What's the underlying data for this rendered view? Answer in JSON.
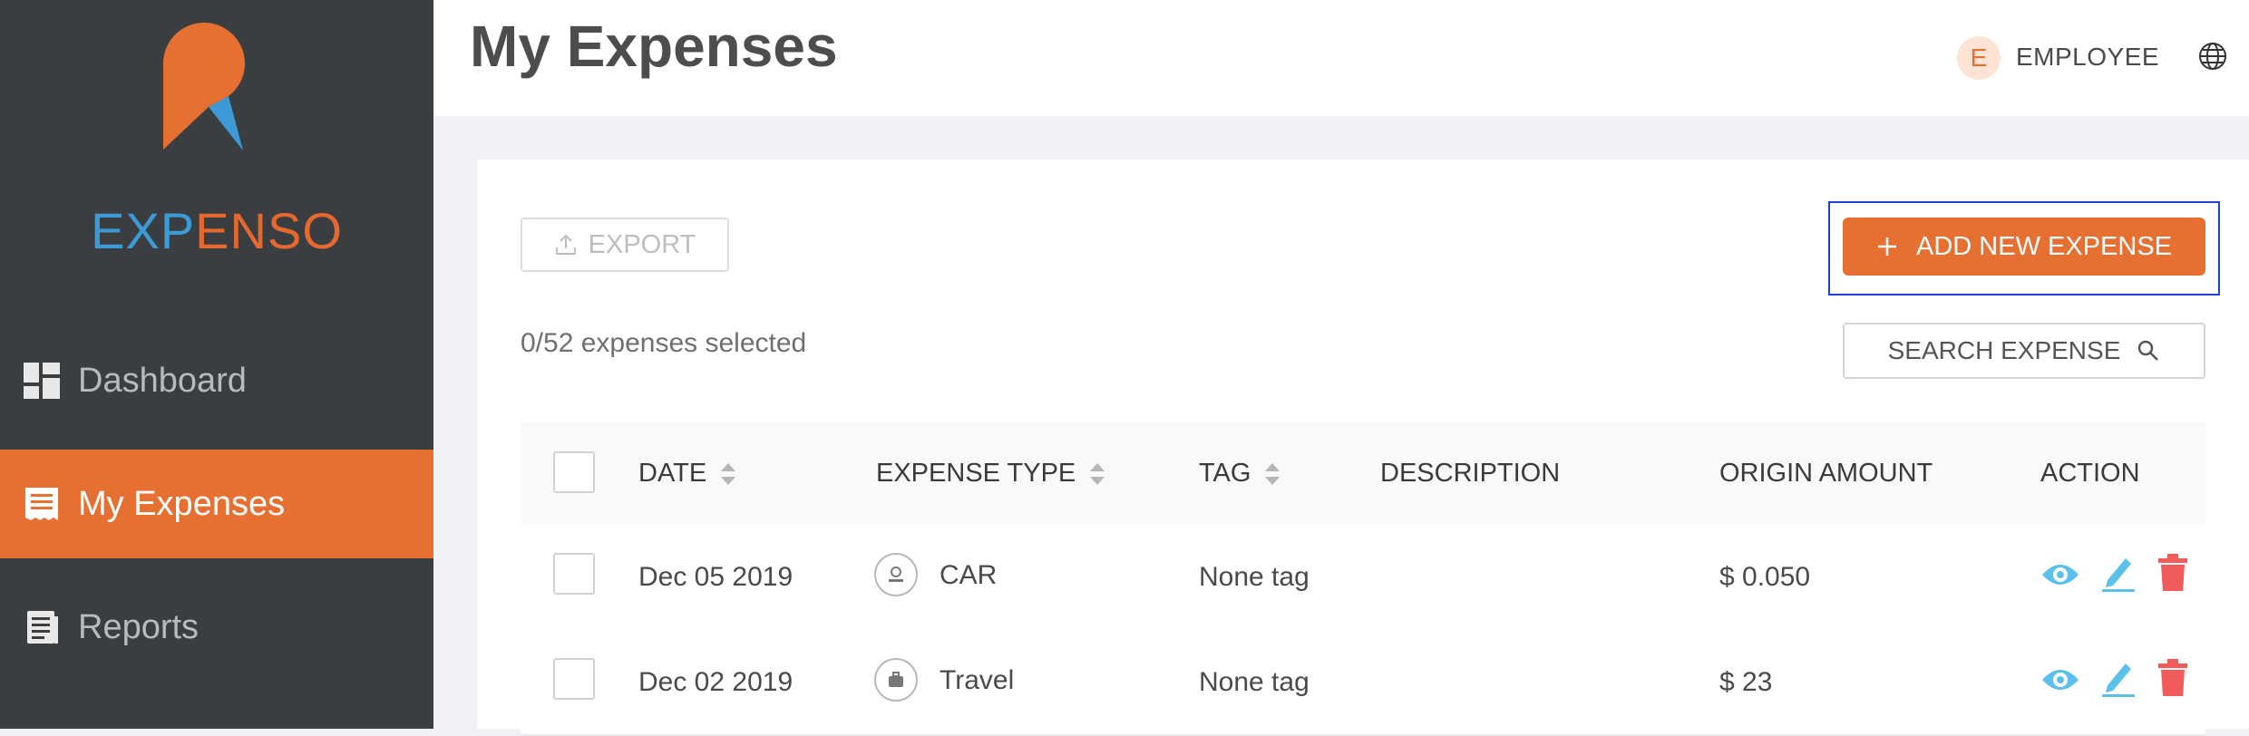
{
  "sidebar": {
    "brand": {
      "part1": "EXP",
      "part2": "ENSO"
    },
    "items": [
      {
        "label": "Dashboard",
        "icon": "dashboard-icon",
        "active": false
      },
      {
        "label": "My Expenses",
        "icon": "receipt-icon",
        "active": true
      },
      {
        "label": "Reports",
        "icon": "report-icon",
        "active": false
      }
    ]
  },
  "header": {
    "title": "My Expenses",
    "user_initial": "E",
    "user_role": "EMPLOYEE",
    "language_icon": "globe-icon"
  },
  "toolbar": {
    "export_label": "EXPORT",
    "add_label": "ADD NEW EXPENSE",
    "selection_text": "0/52 expenses selected",
    "search_label": "SEARCH EXPENSE"
  },
  "table": {
    "columns": [
      "DATE",
      "EXPENSE TYPE",
      "TAG",
      "DESCRIPTION",
      "ORIGIN AMOUNT",
      "ACTION"
    ],
    "rows": [
      {
        "date": "Dec 05 2019",
        "type": "CAR",
        "type_icon": "car-icon",
        "tag": "None tag",
        "description": "",
        "amount": "$ 0.050"
      },
      {
        "date": "Dec 02 2019",
        "type": "Travel",
        "type_icon": "luggage-icon",
        "tag": "None tag",
        "description": "",
        "amount": "$ 23"
      }
    ]
  },
  "colors": {
    "brand_orange": "#e57032",
    "brand_blue": "#3d9ad6",
    "sidebar_bg": "#3b3e40",
    "view_icon": "#5bc0ea",
    "delete_icon": "#f15b5b"
  }
}
